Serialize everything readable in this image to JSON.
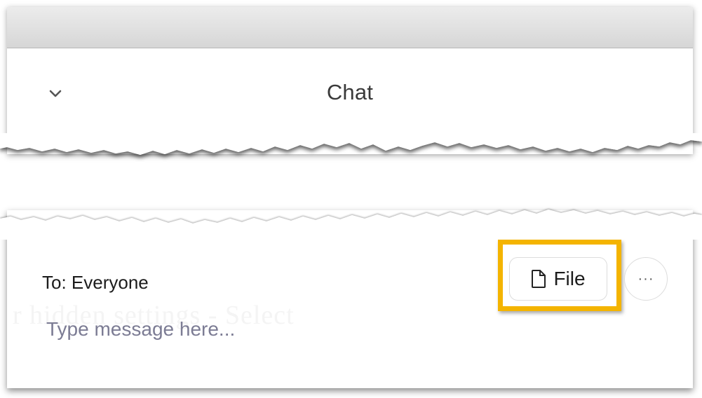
{
  "chat": {
    "title": "Chat",
    "collapse_icon": "chevron-down-icon"
  },
  "composer": {
    "to_label": "To: Everyone",
    "message_placeholder": "Type message here...",
    "file_button_label": "File",
    "file_icon": "file-icon",
    "more_button_label": "···",
    "more_icon": "more-options-icon",
    "ghost_text": "r hidden settings - Select"
  },
  "colors": {
    "highlight": "#f4b400",
    "placeholder": "#7c7c94",
    "titlebar": "#dcdcdc"
  }
}
